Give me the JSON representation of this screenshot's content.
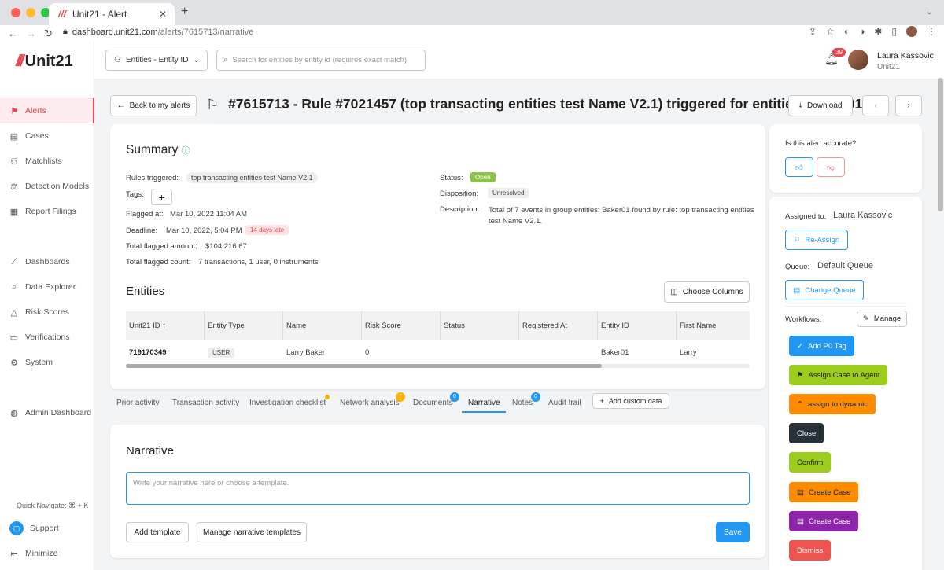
{
  "browser": {
    "tab_title": "Unit21 - Alert",
    "url_host": "dashboard.unit21.com",
    "url_path": "/alerts/7615713/narrative"
  },
  "sidebar": {
    "logo": "Unit21",
    "items": [
      {
        "label": "Alerts",
        "icon": "flag-icon"
      },
      {
        "label": "Cases",
        "icon": "briefcase-icon"
      },
      {
        "label": "Matchlists",
        "icon": "user-plus-icon"
      },
      {
        "label": "Detection Models",
        "icon": "scale-icon"
      },
      {
        "label": "Report Filings",
        "icon": "building-icon"
      },
      {
        "label": "Dashboards",
        "icon": "chart-icon"
      },
      {
        "label": "Data Explorer",
        "icon": "database-search-icon"
      },
      {
        "label": "Risk Scores",
        "icon": "warning-icon"
      },
      {
        "label": "Verifications",
        "icon": "id-card-icon"
      },
      {
        "label": "System",
        "icon": "gear-icon"
      },
      {
        "label": "Admin Dashboard",
        "icon": "globe-icon"
      }
    ],
    "quick_navigate": "Quick Navigate: ⌘ + K",
    "support": "Support",
    "minimize": "Minimize"
  },
  "topbar": {
    "entity_select": "Entities - Entity ID",
    "search_placeholder": "Search for entities by entity id (requires exact match)",
    "notifications": "39",
    "user_name": "Laura Kassovic",
    "user_org": "Unit21"
  },
  "header": {
    "back": "Back to my alerts",
    "title": "#7615713 - Rule #7021457 (top transacting entities test Name V2.1) triggered for entities: Baker01",
    "download": "Download"
  },
  "summary": {
    "title": "Summary",
    "rules_triggered_label": "Rules triggered:",
    "rules_triggered": "top transacting entities test Name V2.1",
    "tags_label": "Tags:",
    "flagged_at_label": "Flagged at:",
    "flagged_at": "Mar 10, 2022 11:04 AM",
    "deadline_label": "Deadline:",
    "deadline": "Mar 10, 2022, 5:04 PM",
    "late": "14 days late",
    "amount_label": "Total flagged amount:",
    "amount": "$104,216.67",
    "count_label": "Total flagged count:",
    "count": "7 transactions, 1 user, 0 instruments",
    "status_label": "Status:",
    "status": "Open",
    "disposition_label": "Disposition:",
    "disposition": "Unresolved",
    "description_label": "Description:",
    "description": "Total of 7 events in group entities: Baker01 found by rule: top transacting entities test Name V2.1."
  },
  "entities": {
    "title": "Entities",
    "choose_columns": "Choose Columns",
    "columns": [
      "Unit21 ID",
      "Entity Type",
      "Name",
      "Risk Score",
      "Status",
      "Registered At",
      "Entity ID",
      "First Name"
    ],
    "row": [
      "719170349",
      "USER",
      "Larry Baker",
      "0",
      "",
      "",
      "Baker01",
      "Larry"
    ]
  },
  "tabs": {
    "items": [
      "Prior activity",
      "Transaction activity",
      "Investigation checklist",
      "Network analysis",
      "Documents",
      "Narrative",
      "Notes",
      "Audit trail"
    ],
    "documents_count": "0",
    "notes_count": "0",
    "network_alert": "!",
    "add_custom": "Add custom data"
  },
  "narrative": {
    "title": "Narrative",
    "placeholder": "Write your narrative here or choose a template.",
    "add_template": "Add template",
    "manage_templates": "Manage narrative templates",
    "save": "Save"
  },
  "accuracy": {
    "question": "Is this alert accurate?"
  },
  "assignment": {
    "assigned_label": "Assigned to:",
    "assigned": "Laura Kassovic",
    "reassign": "Re-Assign",
    "queue_label": "Queue:",
    "queue": "Default Queue",
    "change_queue": "Change Queue",
    "workflows_label": "Workflows:",
    "manage": "Manage",
    "workflows": [
      {
        "label": "Add P0 Tag",
        "color": "#2196f3"
      },
      {
        "label": "Assign Case to Agent",
        "color": "#9ccc1c"
      },
      {
        "label": "assign to dynamic",
        "color": "#ff8c00"
      },
      {
        "label": "Close",
        "color": "#263238"
      },
      {
        "label": "Confirm",
        "color": "#9ccc1c"
      },
      {
        "label": "Create Case",
        "color": "#ff8c00"
      },
      {
        "label": "Create Case",
        "color": "#8e24aa"
      },
      {
        "label": "Dismiss",
        "color": "#ef5350"
      }
    ]
  }
}
